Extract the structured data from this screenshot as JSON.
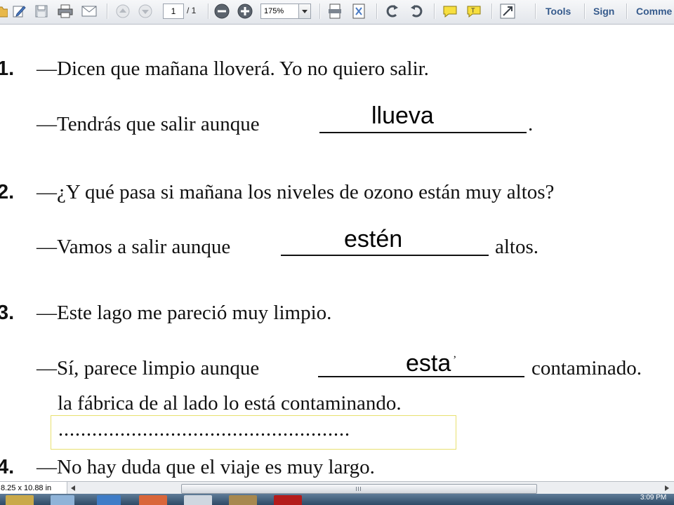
{
  "toolbar": {
    "page_current": "1",
    "page_total": "/ 1",
    "zoom_value": "175%",
    "tools_label": "Tools",
    "sign_label": "Sign",
    "comment_label": "Comme",
    "icons": [
      "open-icon",
      "edit-icon",
      "save-icon",
      "print-icon",
      "email-icon",
      "page-up-icon",
      "page-down-icon",
      "zoom-out-icon",
      "zoom-in-icon",
      "fit-width-icon",
      "fit-page-icon",
      "rotate-ccw-icon",
      "rotate-cw-icon",
      "comment-icon",
      "highlight-icon",
      "fullscreen-icon"
    ]
  },
  "document": {
    "items": [
      {
        "number": "1.",
        "line1": "—Dicen que mañana lloverá. Yo no quiero salir.",
        "line2_before": "—Tendrás que salir aunque",
        "line2_after": ".",
        "answer": "llueva"
      },
      {
        "number": "2.",
        "line1": "—¿Y qué pasa si mañana los niveles de ozono están muy altos?",
        "line2_before": "—Vamos a salir aunque",
        "line2_after": "altos.",
        "answer": "estén"
      },
      {
        "number": "3.",
        "line1": "—Este lago me pareció muy limpio.",
        "line2_before": "—Sí, parece limpio aunque",
        "line2_after": "contaminado.",
        "answer": "esta",
        "answer_mark": "’",
        "line3": "la fábrica de al lado lo está contaminando."
      },
      {
        "number": "4.",
        "line1": "—No hay duda que el viaje es muy largo."
      }
    ],
    "dotted_box": "...................................................."
  },
  "status": {
    "page_size": "8.25 x 10.88 in"
  },
  "taskbar": {
    "clock": "3:09 PM"
  },
  "colors": {
    "toolbar_text": "#355a8c",
    "highlight_box_border": "#e8e070",
    "taskbar": "#2e4a66"
  }
}
